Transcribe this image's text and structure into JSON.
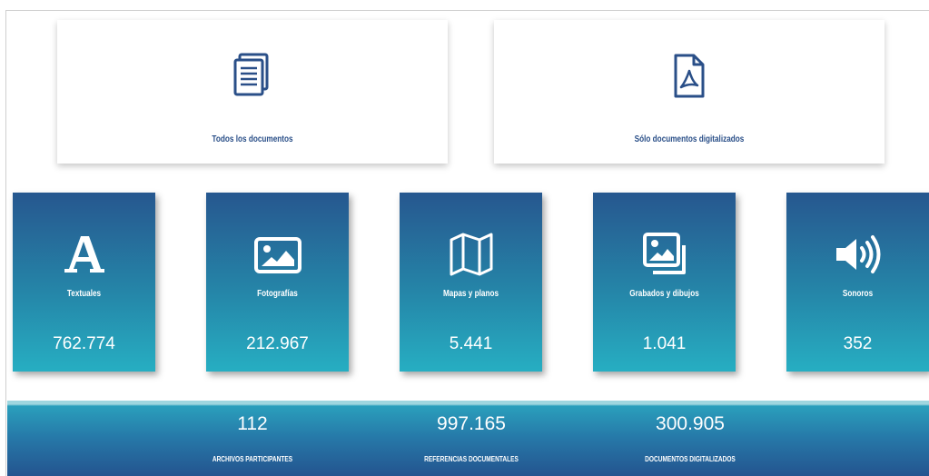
{
  "cards": [
    {
      "icon": "documents-icon",
      "label": "Todos los documentos"
    },
    {
      "icon": "pdf-document-icon",
      "label": "Sólo documentos digitalizados"
    }
  ],
  "categories": [
    {
      "icon": "letter-a-icon",
      "label": "Textuales",
      "value": "762.774"
    },
    {
      "icon": "image-icon",
      "label": "Fotografías",
      "value": "212.967"
    },
    {
      "icon": "map-icon",
      "label": "Mapas y planos",
      "value": "5.441"
    },
    {
      "icon": "images-icon",
      "label": "Grabados y dibujos",
      "value": "1.041"
    },
    {
      "icon": "speaker-icon",
      "label": "Sonoros",
      "value": "352"
    }
  ],
  "stats": [
    {
      "value": "112",
      "label": "ARCHIVOS PARTICIPANTES"
    },
    {
      "value": "997.165",
      "label": "REFERENCIAS DOCUMENTALES"
    },
    {
      "value": "300.905",
      "label": "DOCUMENTOS DIGITALIZADOS"
    }
  ],
  "colors": {
    "accent": "#2a4f88",
    "tile_top": "#26578f",
    "tile_bottom": "#26aec2"
  }
}
